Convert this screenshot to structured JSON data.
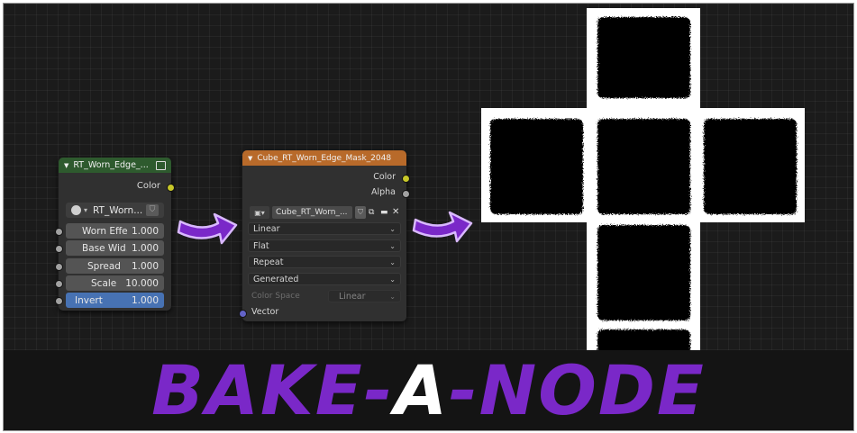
{
  "node1": {
    "title": "RT_Worn_Edge_...",
    "output_color": "Color",
    "group_selector": "RT_Worn...",
    "fields": [
      {
        "label": "Worn Effe",
        "value": "1.000"
      },
      {
        "label": "Base Wid",
        "value": "1.000"
      },
      {
        "label": "Spread",
        "value": "1.000"
      },
      {
        "label": "Scale",
        "value": "10.000"
      },
      {
        "label": "Invert",
        "value": "1.000"
      }
    ]
  },
  "node2": {
    "title": "Cube_RT_Worn_Edge_Mask_2048",
    "outputs": [
      "Color",
      "Alpha"
    ],
    "image_name": "Cube_RT_Worn_...",
    "interpolation": "Linear",
    "projection": "Flat",
    "extension": "Repeat",
    "source": "Generated",
    "color_space_label": "Color Space",
    "color_space_value": "Linear",
    "input_vector": "Vector"
  },
  "banner": {
    "part1": "BAKE-",
    "part2": "A",
    "part3": "-NODE"
  },
  "colors": {
    "accent_purple": "#7a28c8",
    "node1_header": "#2e5a2e",
    "node2_header": "#b86a2a",
    "socket_yellow": "#c7c729",
    "socket_gray": "#a1a1a1",
    "socket_blue": "#6363c7",
    "field_blue": "#4772b3"
  }
}
